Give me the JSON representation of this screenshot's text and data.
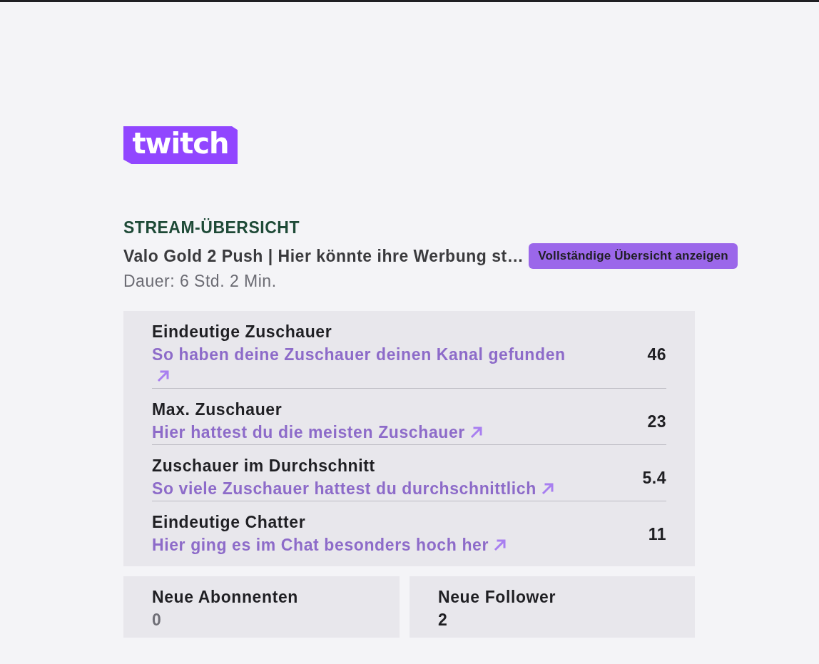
{
  "logo": {
    "text": "twitch"
  },
  "summary": {
    "heading": "STREAM-ÜBERSICHT",
    "title": "Valo Gold 2 Push | Hier könnte ihre Werbung st…",
    "button": "Vollständige Übersicht anzeigen",
    "duration": "Dauer: 6 Std. 2 Min."
  },
  "stats": [
    {
      "label": "Eindeutige Zuschauer",
      "link": "So haben deine Zuschauer deinen Kanal gefunden",
      "value": "46"
    },
    {
      "label": "Max. Zuschauer",
      "link": "Hier hattest du die meisten Zuschauer",
      "value": "23"
    },
    {
      "label": "Zuschauer im Durchschnitt",
      "link": "So viele Zuschauer hattest du durchschnittlich",
      "value": "5.4"
    },
    {
      "label": "Eindeutige Chatter",
      "link": "Hier ging es im Chat besonders hoch her",
      "value": "11"
    }
  ],
  "cards": [
    {
      "label": "Neue Abonnenten",
      "value": "0",
      "dimmed": true
    },
    {
      "label": "Neue Follower",
      "value": "2",
      "dimmed": false
    }
  ]
}
